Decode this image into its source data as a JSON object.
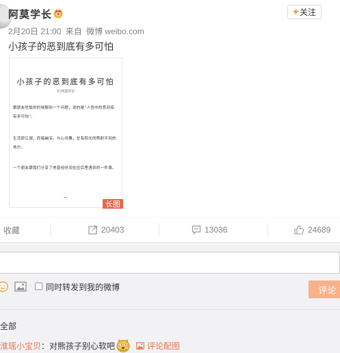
{
  "post": {
    "username": "阿莫学长",
    "follow_label": "关注",
    "date": "2月20日 21:00",
    "source_prefix": "来自",
    "source": "微博 weibo.com",
    "text": "小孩子的恶到底有多可怕"
  },
  "long_image": {
    "title": "小孩子的恶到底有多可怕",
    "author": "文/阿莫学长",
    "paragraphs": [
      "跟朋友吃饭的时候聊到一个问题，说的是“人性中的恶到底有多可怕”。",
      "生活即江湖，而暗幽深，与心共舞，总有阳光所照射不到的地方。",
      "一个朋友跟我们分享了他曾经时间在拉后里遇到的一件事。"
    ],
    "end_mark": "—",
    "badge": "长图"
  },
  "actions": {
    "favorite": "收藏",
    "forward_count": "20403",
    "comment_count": "13036",
    "like_count": "24689"
  },
  "comment_box": {
    "forward_label": "同时转发到我的微博",
    "submit_label": "评论"
  },
  "comments": {
    "all_label": "全部",
    "first": {
      "user": "淮瑶小宝贝",
      "text": "：对熊孩子别心软吧",
      "pic_link": "评论配图"
    }
  },
  "colors": {
    "accent": "#ff8200",
    "link": "#eb7350",
    "badge_bg": "#e5664d",
    "submit_bg": "#f7b28a",
    "comment_bg": "#f2f2f5"
  }
}
